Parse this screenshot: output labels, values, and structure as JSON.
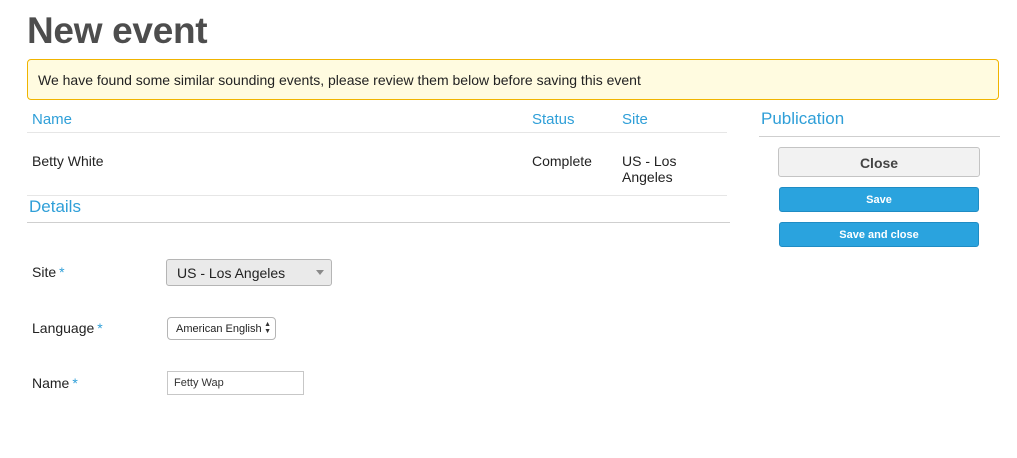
{
  "page": {
    "title": "New event"
  },
  "warning": {
    "message": "We have found some similar sounding events, please review them below before saving this event"
  },
  "similar_events": {
    "columns": {
      "name": "Name",
      "status": "Status",
      "site": "Site"
    },
    "rows": [
      {
        "name": "Betty White",
        "status": "Complete",
        "site": "US - Los Angeles"
      }
    ]
  },
  "details": {
    "heading": "Details",
    "required_marker": "*",
    "site": {
      "label": "Site",
      "value": "US - Los Angeles"
    },
    "language": {
      "label": "Language",
      "value": "American English"
    },
    "name": {
      "label": "Name",
      "value": "Fetty Wap"
    }
  },
  "publication": {
    "heading": "Publication",
    "close_label": "Close",
    "save_label": "Save",
    "save_and_close_label": "Save and close"
  },
  "colors": {
    "accent": "#2f9fd8",
    "button_blue": "#2aa3de",
    "warning_bg": "#fffbe0",
    "warning_border": "#f0b400"
  }
}
